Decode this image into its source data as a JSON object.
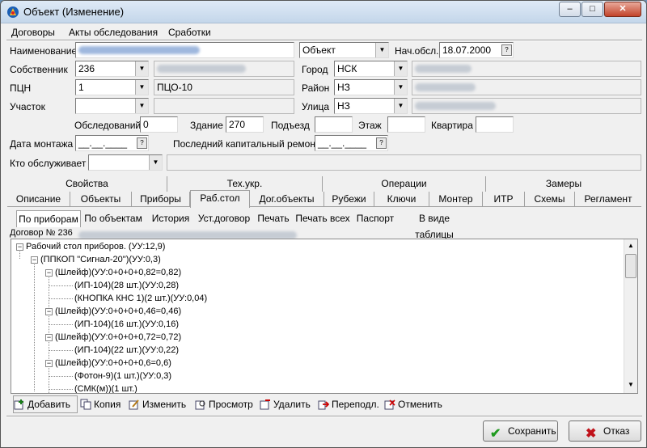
{
  "window": {
    "title": "Объект (Изменение)",
    "minimize": "–",
    "maximize": "□",
    "close": "✕"
  },
  "menu": [
    "Договоры",
    "Акты обследования",
    "Сработки"
  ],
  "form": {
    "name_label": "Наименование",
    "type_value": "Объект",
    "start_label": "Нач.обсл.",
    "start_value": "18.07.2000",
    "owner_label": "Собственник",
    "owner_value": "236",
    "city_label": "Город",
    "city_value": "НСК",
    "pcn_label": "ПЦН",
    "pcn_value": "1",
    "pcn_name": "ПЦО-10",
    "district_label": "Район",
    "district_value": "НЗ",
    "section_label": "Участок",
    "street_label": "Улица",
    "street_value": "НЗ",
    "surveyed_label": "Обследований",
    "surveyed_value": "0",
    "building_label": "Здание",
    "building_value": "270",
    "entrance_label": "Подъезд",
    "floor_label": "Этаж",
    "flat_label": "Квартира",
    "install_label": "Дата монтажа",
    "install_value": "__.__.____",
    "repair_label": "Последний капитальный ремонт",
    "repair_value": "__.__.____",
    "service_label": "Кто обслуживает"
  },
  "tabs_back": [
    "Свойства",
    "Тех.укр.",
    "Операции",
    "Замеры"
  ],
  "tabs_front": [
    "Описание",
    "Объекты",
    "Приборы",
    "Раб.стол",
    "Дог.объекты",
    "Рубежи",
    "Ключи",
    "Монтер",
    "ИТР",
    "Схемы",
    "Регламент"
  ],
  "subtabs": [
    "По приборам",
    "По объектам",
    "История",
    "Уст.договор",
    "Печать",
    "Печать всех",
    "Паспорт",
    "В виде таблицы"
  ],
  "contract_label": "Договор № 236",
  "tree": [
    "Рабочий стол приборов. (УУ:12,9)",
    "(ППКОП \"Сигнал-20\")(УУ:0,3)",
    "(Шлейф)(УУ:0+0+0+0,82=0,82)",
    "(ИП-104)(28 шт.)(УУ:0,28)",
    "(КНОПКА КНС 1)(2 шт.)(УУ:0,04)",
    "(Шлейф)(УУ:0+0+0+0,46=0,46)",
    "(ИП-104)(16 шт.)(УУ:0,16)",
    "(Шлейф)(УУ:0+0+0+0,72=0,72)",
    "(ИП-104)(22 шт.)(УУ:0,22)",
    "(Шлейф)(УУ:0+0+0+0,6=0,6)",
    "(Фотон-9)(1 шт.)(УУ:0,3)",
    "(СМК(м))(1 шт.)"
  ],
  "toolbar": [
    "Добавить",
    "Копия",
    "Изменить",
    "Просмотр",
    "Удалить",
    "Переподл.",
    "Отменить"
  ],
  "buttons": {
    "save": "Сохранить",
    "cancel": "Отказ"
  },
  "colors": {
    "save_check": "#1f9a1f",
    "cancel_x": "#c0121a"
  }
}
